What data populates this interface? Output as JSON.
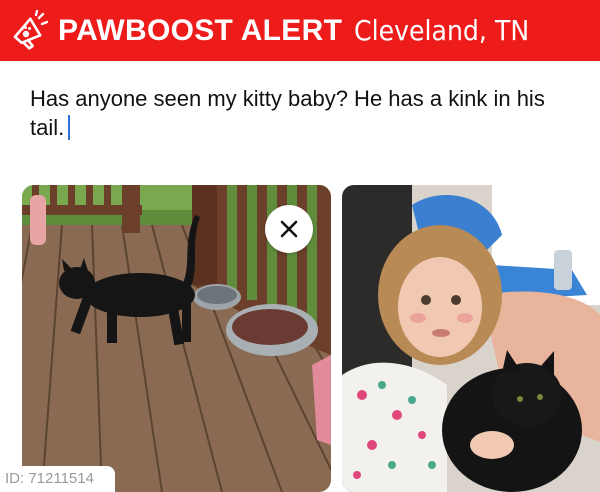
{
  "banner": {
    "brand": "PAWBOOST ALERT",
    "location": "Cleveland, TN",
    "background_color": "#ee1b1b",
    "logo_icon": "megaphone-paw-icon"
  },
  "post": {
    "text": "Has anyone seen my kitty baby? He has a kink in his tail."
  },
  "photos": [
    {
      "subject": "black cat on wooden porch"
    },
    {
      "subject": "child holding black cat"
    }
  ],
  "close_icon": "close-icon",
  "id_label": "ID: 71211514"
}
